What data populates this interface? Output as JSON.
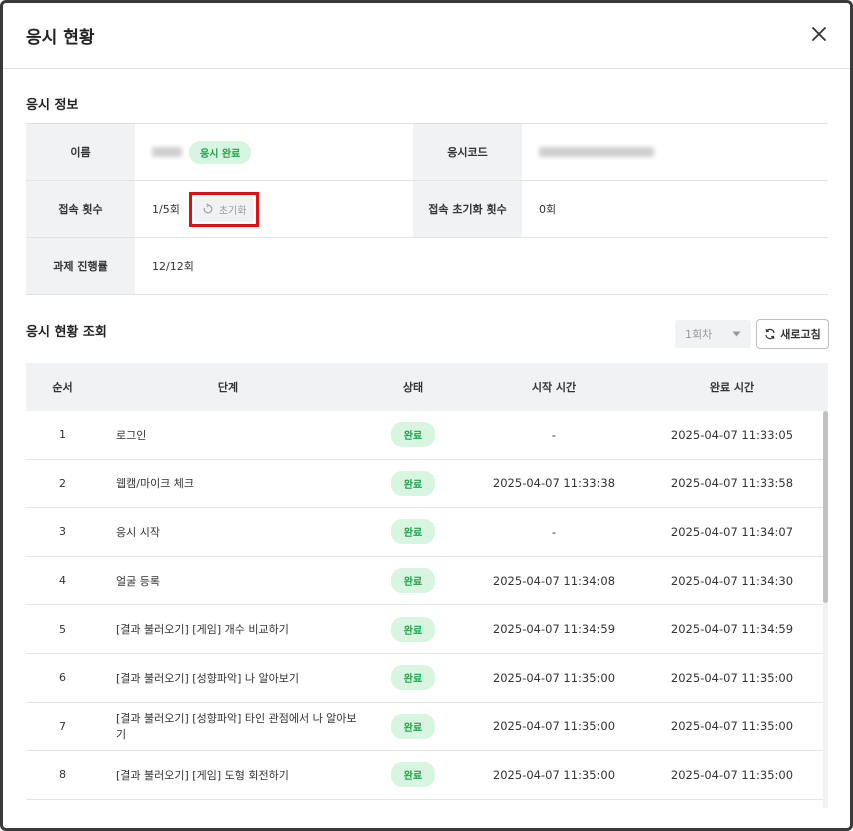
{
  "header": {
    "title": "응시 현황"
  },
  "info": {
    "section_title": "응시 정보",
    "name_label": "이름",
    "name_status": "응시 완료",
    "code_label": "응시코드",
    "access_label": "접속 횟수",
    "access_value": "1/5회",
    "reset_label": "초기화",
    "reset_count_label": "접속 초기화 횟수",
    "reset_count_value": "0회",
    "progress_label": "과제 진행률",
    "progress_value": "12/12회"
  },
  "status_section": {
    "title": "응시 현황 조회",
    "round_select": "1회차",
    "refresh_label": "새로고침",
    "columns": [
      "순서",
      "단계",
      "상태",
      "시작 시간",
      "완료 시간"
    ],
    "rows": [
      {
        "no": "1",
        "step": "로그인",
        "status": "완료",
        "start": "-",
        "end": "2025-04-07 11:33:05"
      },
      {
        "no": "2",
        "step": "웹캠/마이크 체크",
        "status": "완료",
        "start": "2025-04-07 11:33:38",
        "end": "2025-04-07 11:33:58"
      },
      {
        "no": "3",
        "step": "응시 시작",
        "status": "완료",
        "start": "-",
        "end": "2025-04-07 11:34:07"
      },
      {
        "no": "4",
        "step": "얼굴 등록",
        "status": "완료",
        "start": "2025-04-07 11:34:08",
        "end": "2025-04-07 11:34:30"
      },
      {
        "no": "5",
        "step": "[결과 불러오기] [게임] 개수 비교하기",
        "status": "완료",
        "start": "2025-04-07 11:34:59",
        "end": "2025-04-07 11:34:59"
      },
      {
        "no": "6",
        "step": "[결과 불러오기] [성향파악] 나 알아보기",
        "status": "완료",
        "start": "2025-04-07 11:35:00",
        "end": "2025-04-07 11:35:00"
      },
      {
        "no": "7",
        "step": "[결과 불러오기] [성향파악] 타인 관점에서 나 알아보기",
        "status": "완료",
        "start": "2025-04-07 11:35:00",
        "end": "2025-04-07 11:35:00"
      },
      {
        "no": "8",
        "step": "[결과 불러오기] [게임] 도형 회전하기",
        "status": "완료",
        "start": "2025-04-07 11:35:00",
        "end": "2025-04-07 11:35:00"
      }
    ]
  },
  "colors": {
    "accent_green": "#1ea34a",
    "badge_green_bg": "#d7f5e0",
    "highlight_red": "#e01010"
  }
}
